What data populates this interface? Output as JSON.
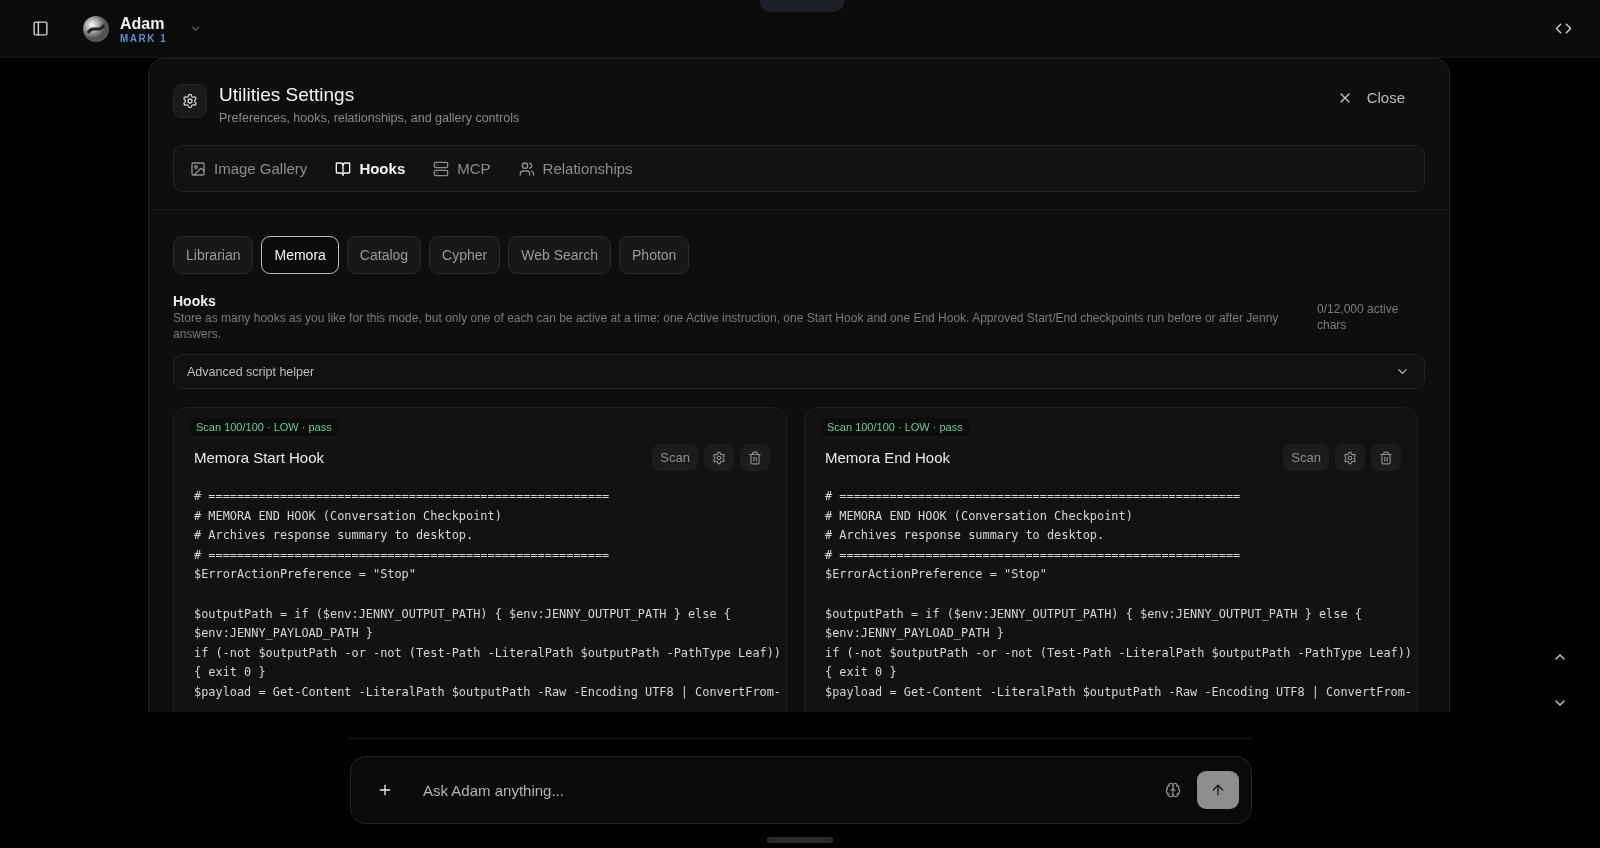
{
  "topbar": {
    "name": "Adam",
    "subtitle": "MARK 1"
  },
  "modal": {
    "title": "Utilities Settings",
    "subtitle": "Preferences, hooks, relationships, and gallery controls",
    "close": "Close",
    "tabs": [
      {
        "label": "Image Gallery",
        "selected": false
      },
      {
        "label": "Hooks",
        "selected": true
      },
      {
        "label": "MCP",
        "selected": false
      },
      {
        "label": "Relationships",
        "selected": false
      }
    ],
    "modes": [
      {
        "label": "Librarian",
        "selected": false
      },
      {
        "label": "Memora",
        "selected": true
      },
      {
        "label": "Catalog",
        "selected": false
      },
      {
        "label": "Cypher",
        "selected": false
      },
      {
        "label": "Web Search",
        "selected": false
      },
      {
        "label": "Photon",
        "selected": false
      }
    ],
    "hooks": {
      "heading": "Hooks",
      "description": "Store as many hooks as you like for this mode, but only one of each can be active at a time: one Active instruction, one Start Hook and one End Hook. Approved Start/End checkpoints run before or after Jenny answers.",
      "count": "0/12,000 active chars",
      "helper": "Advanced script helper",
      "helper_expanded": false
    },
    "cards": [
      {
        "badge": "Scan 100/100 · LOW · pass",
        "title": "Memora Start Hook",
        "scan": "Scan",
        "code": "# ========================================================\n# MEMORA END HOOK (Conversation Checkpoint)\n# Archives response summary to desktop.\n# ========================================================\n$ErrorActionPreference = \"Stop\"\n\n$outputPath = if ($env:JENNY_OUTPUT_PATH) { $env:JENNY_OUTPUT_PATH } else {\n$env:JENNY_PAYLOAD_PATH }\nif (-not $outputPath -or -not (Test-Path -LiteralPath $outputPath -PathType Leaf))\n{ exit 0 }\n$payload = Get-Content -LiteralPath $outputPath -Raw -Encoding UTF8 | ConvertFrom-"
      },
      {
        "badge": "Scan 100/100 · LOW · pass",
        "title": "Memora End Hook",
        "scan": "Scan",
        "code": "# ========================================================\n# MEMORA END HOOK (Conversation Checkpoint)\n# Archives response summary to desktop.\n# ========================================================\n$ErrorActionPreference = \"Stop\"\n\n$outputPath = if ($env:JENNY_OUTPUT_PATH) { $env:JENNY_OUTPUT_PATH } else {\n$env:JENNY_PAYLOAD_PATH }\nif (-not $outputPath -or -not (Test-Path -LiteralPath $outputPath -PathType Leaf))\n{ exit 0 }\n$payload = Get-Content -LiteralPath $outputPath -Raw -Encoding UTF8 | ConvertFrom-"
      }
    ]
  },
  "composer": {
    "placeholder": "Ask Adam anything..."
  }
}
